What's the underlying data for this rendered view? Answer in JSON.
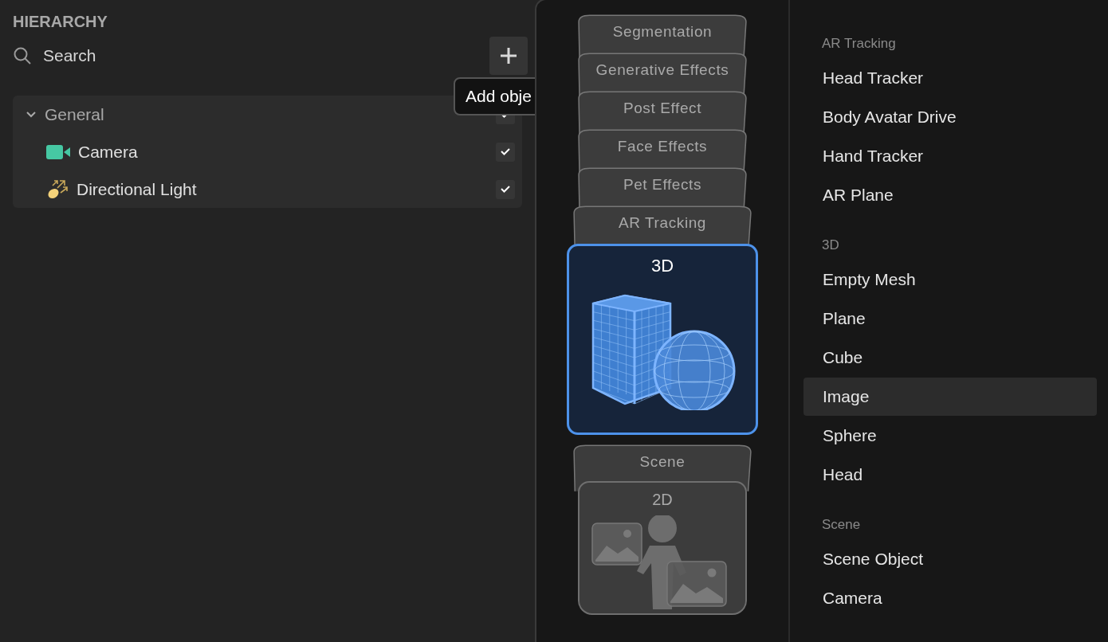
{
  "hierarchy": {
    "title": "HIERARCHY",
    "search": {
      "placeholder": "Search"
    },
    "tooltip": "Add obje",
    "tree": [
      {
        "label": "General",
        "expanded": true,
        "checked": true,
        "children": [
          {
            "label": "Camera",
            "checked": true
          },
          {
            "label": "Directional Light",
            "checked": true
          }
        ]
      }
    ]
  },
  "categories": [
    {
      "label": "Segmentation",
      "kind": "tab",
      "selected": false
    },
    {
      "label": "Generative Effects",
      "kind": "tab",
      "selected": false
    },
    {
      "label": "Post Effect",
      "kind": "tab",
      "selected": false
    },
    {
      "label": "Face Effects",
      "kind": "tab",
      "selected": false
    },
    {
      "label": "Pet Effects",
      "kind": "tab",
      "selected": false
    },
    {
      "label": "AR Tracking",
      "kind": "tab",
      "selected": false
    },
    {
      "label": "3D",
      "kind": "card",
      "selected": true
    },
    {
      "label": "Scene",
      "kind": "tab",
      "selected": false
    },
    {
      "label": "2D",
      "kind": "card",
      "selected": false
    }
  ],
  "sections": [
    {
      "heading": "AR Tracking",
      "items": [
        {
          "label": "Head Tracker",
          "selected": false
        },
        {
          "label": "Body Avatar Drive",
          "selected": false
        },
        {
          "label": "Hand Tracker",
          "selected": false
        },
        {
          "label": "AR Plane",
          "selected": false
        }
      ]
    },
    {
      "heading": "3D",
      "items": [
        {
          "label": "Empty Mesh",
          "selected": false
        },
        {
          "label": "Plane",
          "selected": false
        },
        {
          "label": "Cube",
          "selected": false
        },
        {
          "label": "Image",
          "selected": true
        },
        {
          "label": "Sphere",
          "selected": false
        },
        {
          "label": "Head",
          "selected": false
        }
      ]
    },
    {
      "heading": "Scene",
      "items": [
        {
          "label": "Scene Object",
          "selected": false
        },
        {
          "label": "Camera",
          "selected": false
        }
      ]
    }
  ]
}
